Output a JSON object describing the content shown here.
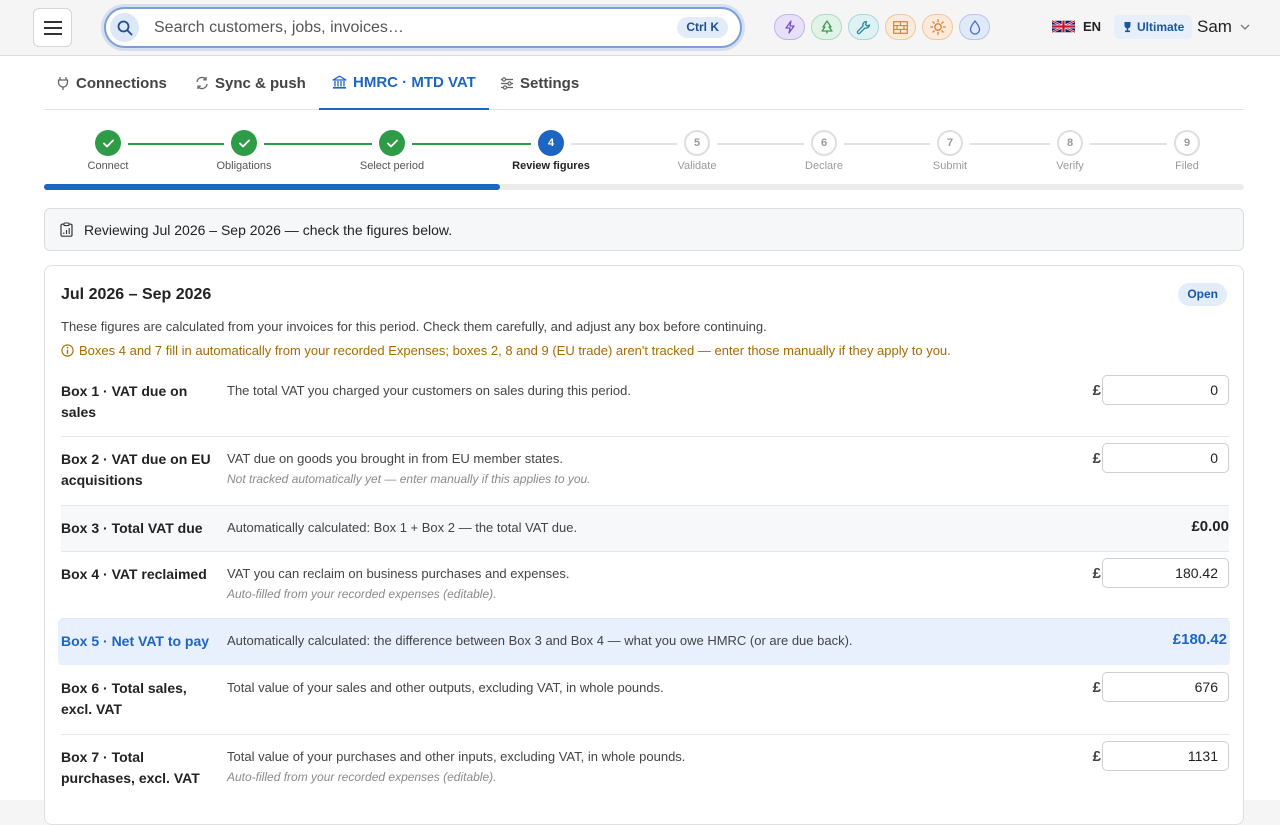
{
  "header": {
    "search": {
      "placeholder": "Search customers, jobs, invoices…",
      "shortcut": "Ctrl K"
    },
    "quick_actions": [
      {
        "name": "bolt-icon",
        "bg": "#e8e0f8",
        "border": "#c3b2ee",
        "color": "#7a52c7"
      },
      {
        "name": "tree-icon",
        "bg": "#e0f3e6",
        "border": "#aedcbc",
        "color": "#3a9a5a"
      },
      {
        "name": "wrench-icon",
        "bg": "#dff1f3",
        "border": "#a7d7de",
        "color": "#2a8a99"
      },
      {
        "name": "brick-icon",
        "bg": "#fcebd8",
        "border": "#f2c79a",
        "color": "#d08530"
      },
      {
        "name": "sun-icon",
        "bg": "#fdeadb",
        "border": "#f3c6a2",
        "color": "#e07a30"
      },
      {
        "name": "droplet-icon",
        "bg": "#dfe9f8",
        "border": "#b2c8ee",
        "color": "#3f70c7"
      }
    ],
    "language": "EN",
    "plan": "Ultimate",
    "user": "Sam"
  },
  "tabs": [
    {
      "label": "Connections",
      "icon": "plug-icon"
    },
    {
      "label": "Sync & push",
      "icon": "sync-icon"
    },
    {
      "label": "HMRC · MTD VAT",
      "icon": "bank-icon",
      "active": true
    },
    {
      "label": "Settings",
      "icon": "sliders-icon"
    }
  ],
  "stepper": {
    "current_step": 4,
    "progress_fraction": 0.38,
    "steps": [
      {
        "num": "1",
        "label": "Connect",
        "state": "done"
      },
      {
        "num": "2",
        "label": "Obligations",
        "state": "done"
      },
      {
        "num": "3",
        "label": "Select period",
        "state": "done"
      },
      {
        "num": "4",
        "label": "Review figures",
        "state": "current"
      },
      {
        "num": "5",
        "label": "Validate",
        "state": "todo"
      },
      {
        "num": "6",
        "label": "Declare",
        "state": "todo"
      },
      {
        "num": "7",
        "label": "Submit",
        "state": "todo"
      },
      {
        "num": "8",
        "label": "Verify",
        "state": "todo"
      },
      {
        "num": "9",
        "label": "Filed",
        "state": "todo"
      }
    ]
  },
  "notice": "Reviewing Jul 2026 – Sep 2026 — check the figures below.",
  "card": {
    "title": "Jul 2026 – Sep 2026",
    "status": "Open",
    "description": "These figures are calculated from your invoices for this period. Check them carefully, and adjust any box before continuing.",
    "warning": "Boxes 4 and 7 fill in automatically from your recorded Expenses; boxes 2, 8 and 9 (EU trade) aren't tracked — enter those manually if they apply to you.",
    "currency": "£",
    "boxes": [
      {
        "label": "Box 1 · VAT due on sales",
        "desc": "The total VAT you charged your customers on sales during this period.",
        "value": "0"
      },
      {
        "label": "Box 2 · VAT due on EU acquisitions",
        "desc": "VAT due on goods you brought in from EU member states.",
        "note": "Not tracked automatically yet — enter manually if this applies to you.",
        "value": "0"
      },
      {
        "label": "Box 3 · Total VAT due",
        "desc": "Automatically calculated: Box 1 + Box 2 — the total VAT due.",
        "total": "£0.00"
      },
      {
        "label": "Box 4 · VAT reclaimed",
        "desc": "VAT you can reclaim on business purchases and expenses.",
        "note": "Auto-filled from your recorded expenses (editable).",
        "value": "180.42"
      },
      {
        "label": "Box 5 · Net VAT to pay",
        "desc": "Automatically calculated: the difference between Box 3 and Box 4 — what you owe HMRC (or are due back).",
        "total": "£180.42"
      },
      {
        "label": "Box 6 · Total sales, excl. VAT",
        "desc": "Total value of your sales and other outputs, excluding VAT, in whole pounds.",
        "value": "676"
      },
      {
        "label": "Box 7 · Total purchases, excl. VAT",
        "desc": "Total value of your purchases and other inputs, excluding VAT, in whole pounds.",
        "note": "Auto-filled from your recorded expenses (editable).",
        "value": "1131"
      }
    ]
  },
  "colors": {
    "accent": "#1d65c2",
    "success": "#2e9c47",
    "warning": "#a86a00",
    "highlight_bg": "#e7f0fc"
  }
}
